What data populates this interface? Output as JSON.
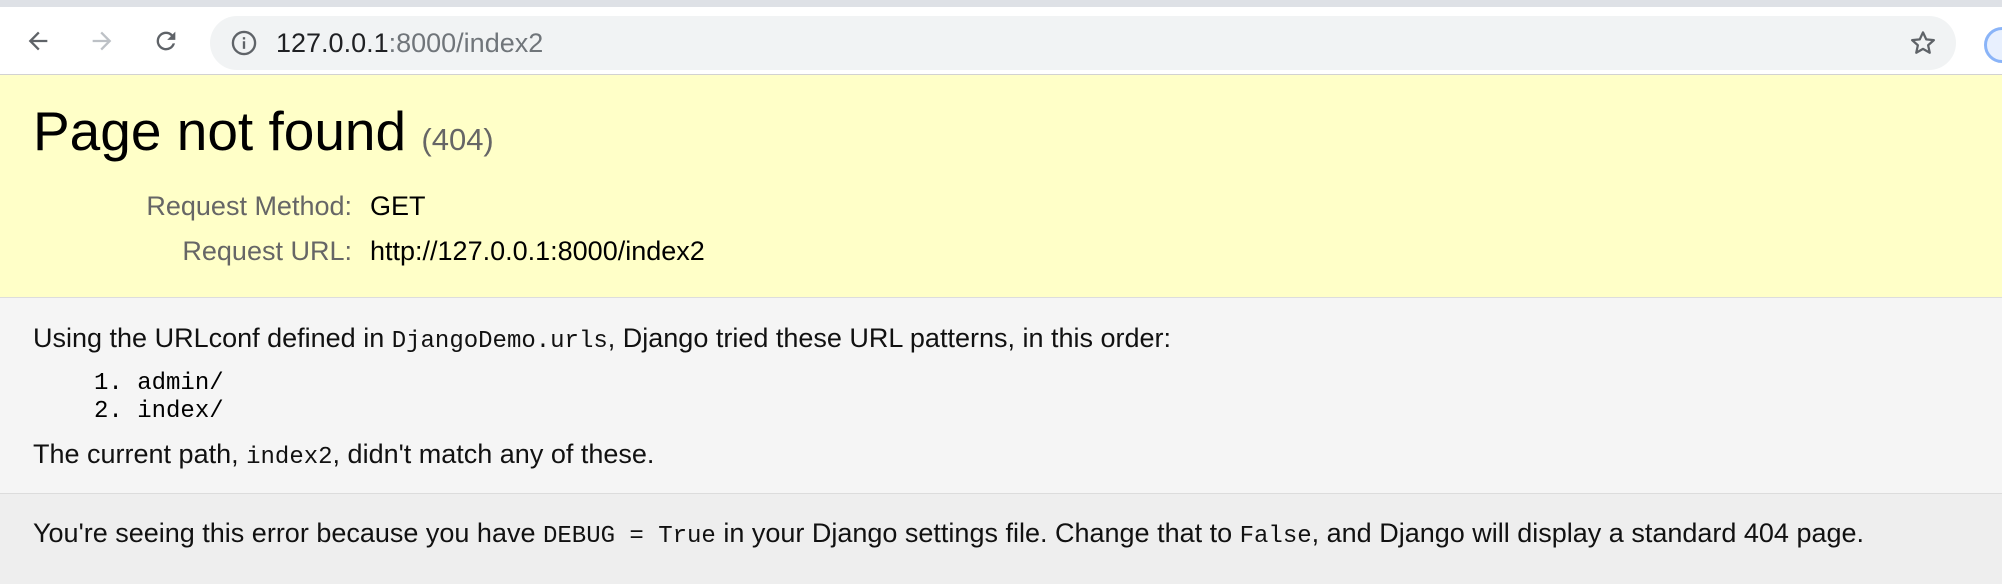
{
  "browser": {
    "url_host": "127.0.0.1",
    "url_rest": ":8000/index2",
    "icons": {
      "back": "arrow-left-icon",
      "forward": "arrow-right-icon",
      "reload": "reload-icon",
      "info": "info-icon",
      "bookmark": "star-icon",
      "extension": "extension-icon"
    }
  },
  "summary": {
    "title": "Page not found",
    "status_code": "(404)",
    "request_method_label": "Request Method:",
    "request_method_value": "GET",
    "request_url_label": "Request URL:",
    "request_url_value": "http://127.0.0.1:8000/index2",
    "background_color": "#ffffc8"
  },
  "info": {
    "urlconf_prefix": "Using the URLconf defined in ",
    "urlconf_module": "DjangoDemo.urls",
    "urlconf_suffix": ", Django tried these URL patterns, in this order:",
    "patterns": [
      {
        "number": "1.",
        "pattern": "admin/"
      },
      {
        "number": "2.",
        "pattern": "index/"
      }
    ],
    "current_path_prefix": "The current path, ",
    "current_path": "index2",
    "current_path_suffix": ", didn't match any of these."
  },
  "explanation": {
    "prefix": "You're seeing this error because you have ",
    "debug_setting": "DEBUG = True",
    "middle": " in your Django settings file. Change that to ",
    "false_value": "False",
    "suffix": ", and Django will display a standard 404 page."
  }
}
